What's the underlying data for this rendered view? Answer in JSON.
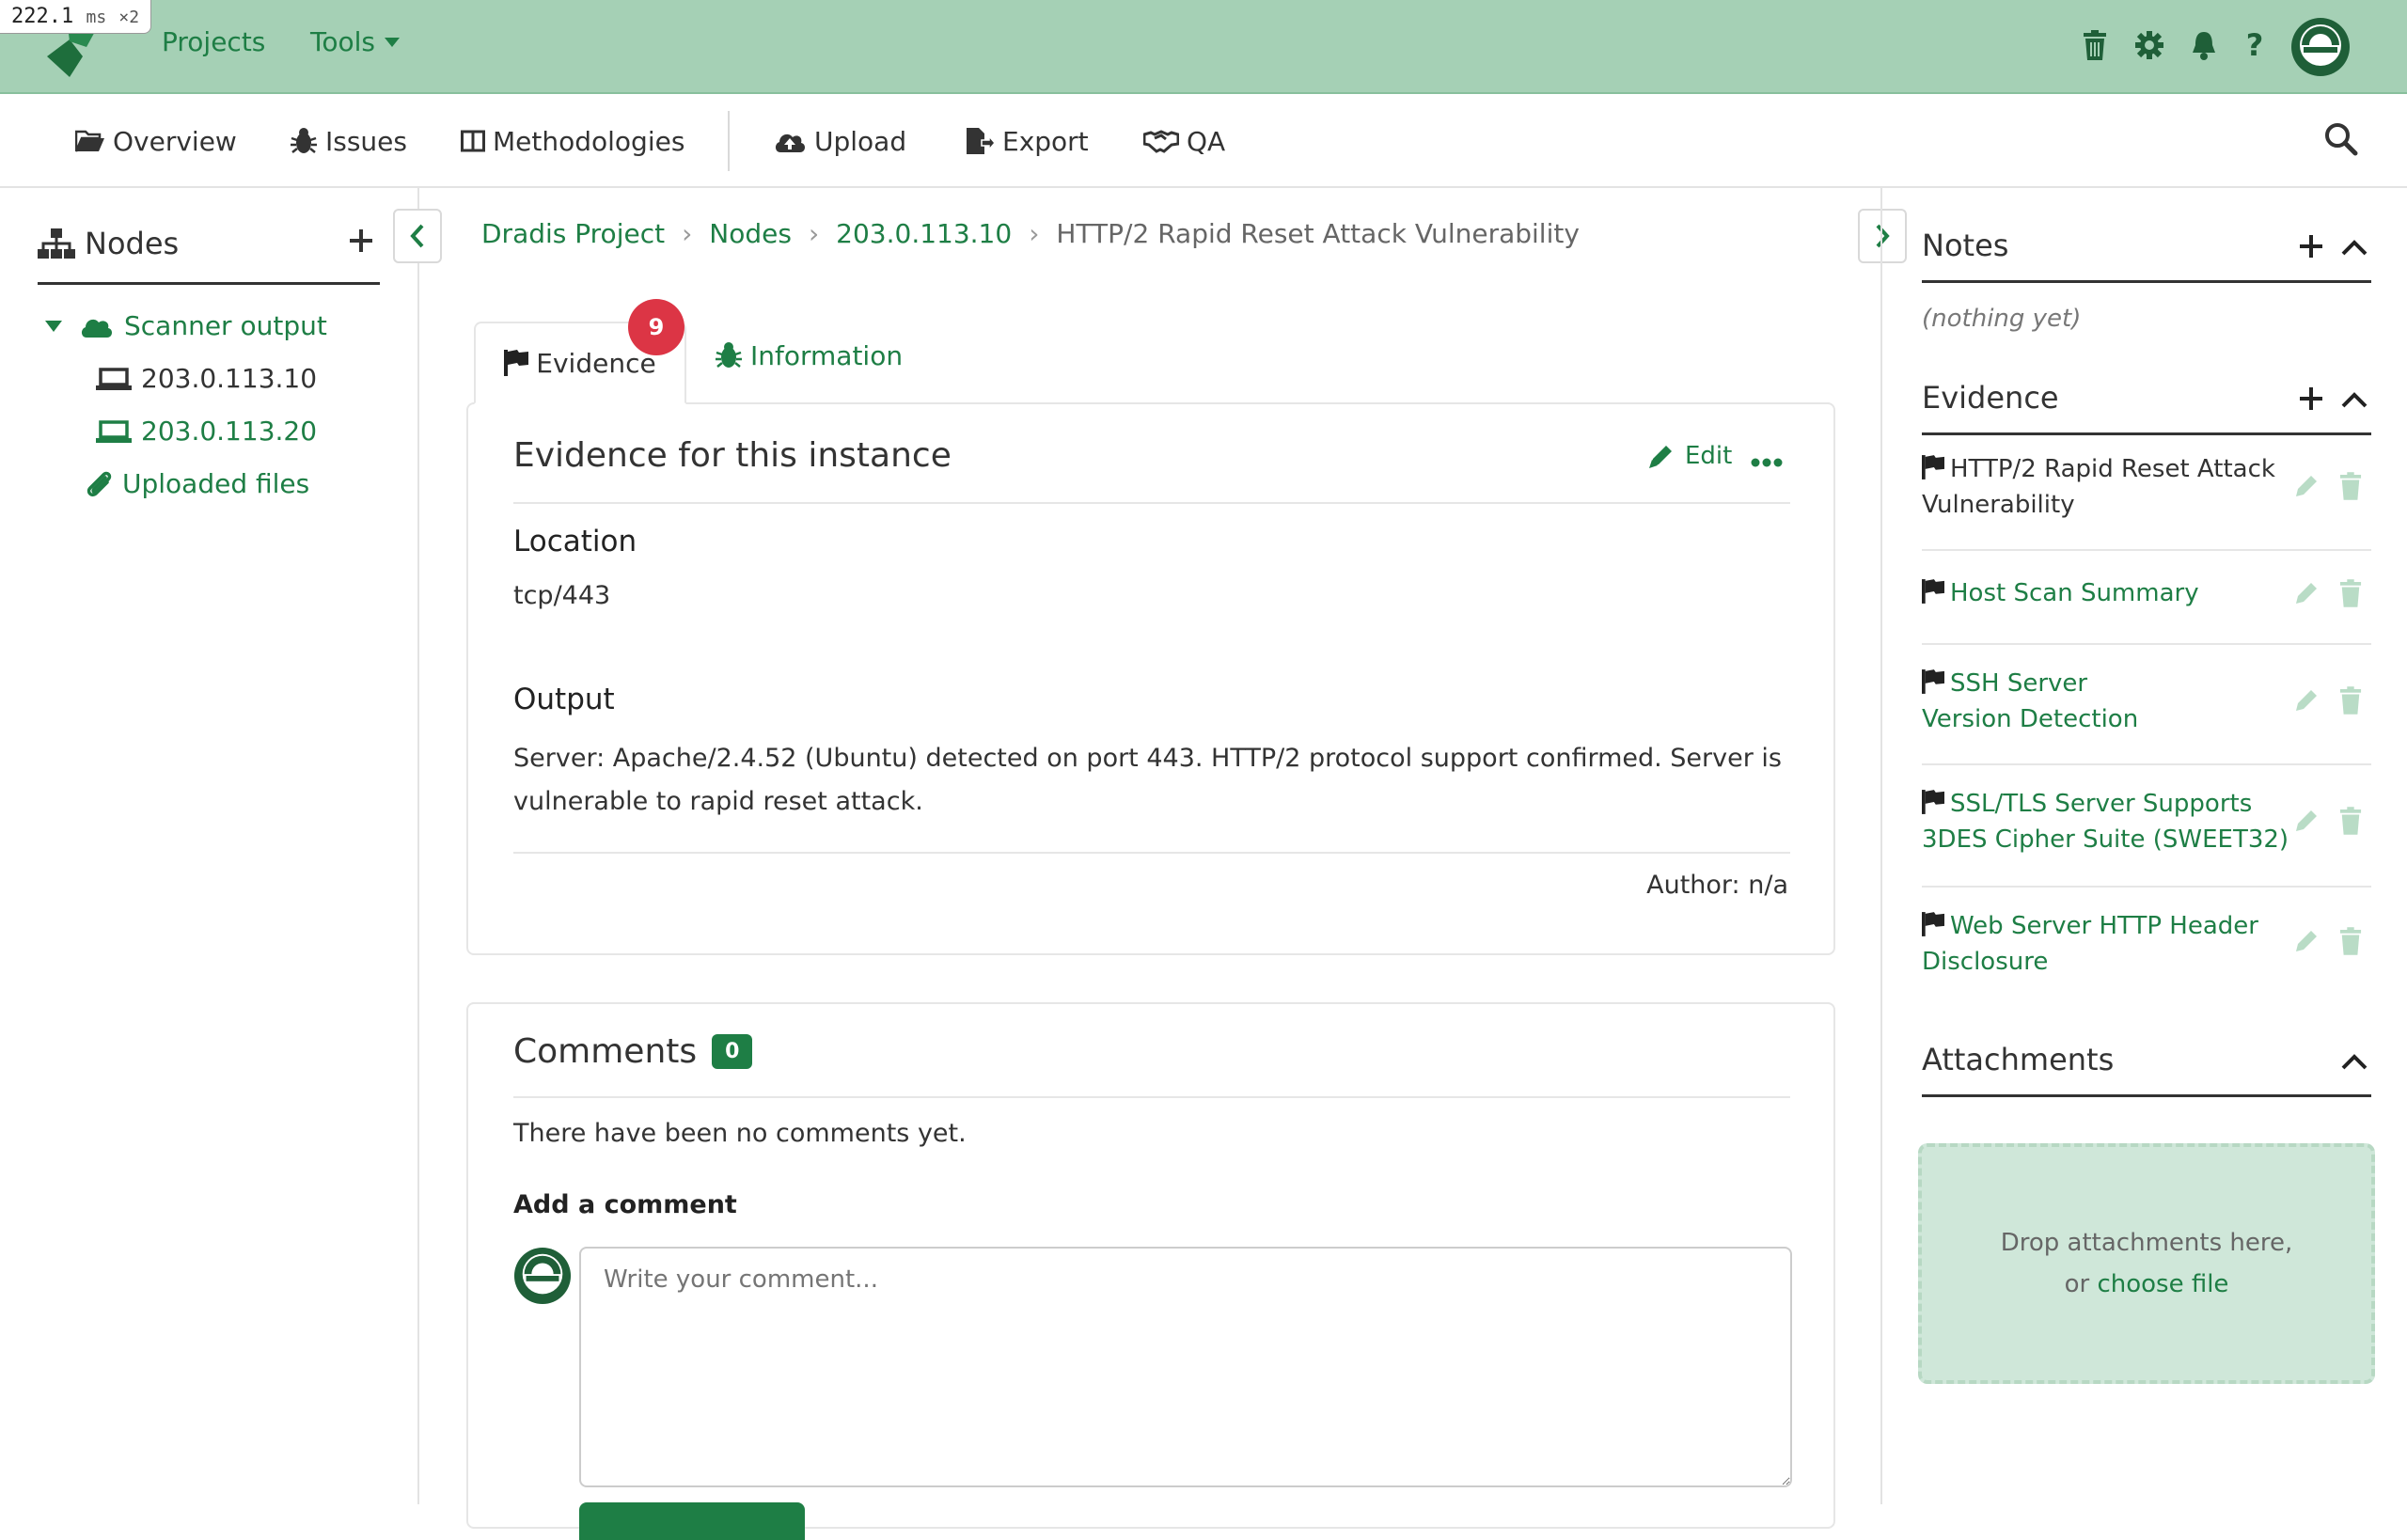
{
  "perf": {
    "value": "222.1",
    "unit": "ms",
    "mult": "×2"
  },
  "topbar": {
    "projects": "Projects",
    "tools": "Tools",
    "icons": [
      "trash-icon",
      "gear-icon",
      "bell-icon",
      "question-icon",
      "avatar"
    ]
  },
  "subnav": {
    "overview": "Overview",
    "issues": "Issues",
    "methodologies": "Methodologies",
    "upload": "Upload",
    "export": "Export",
    "qa": "QA"
  },
  "left": {
    "title": "Nodes",
    "tree": {
      "scanner": "Scanner output",
      "host1": "203.0.113.10",
      "host2": "203.0.113.20",
      "uploaded": "Uploaded files"
    }
  },
  "breadcrumb": [
    "Dradis Project",
    "Nodes",
    "203.0.113.10",
    "HTTP/2 Rapid Reset Attack Vulnerability"
  ],
  "tabs": {
    "evidence": "Evidence",
    "evidence_badge": "9",
    "information": "Information"
  },
  "evidence": {
    "title": "Evidence for this instance",
    "edit": "Edit",
    "location_label": "Location",
    "location_value": "tcp/443",
    "output_label": "Output",
    "output_line1": "Server: Apache/2.4.52 (Ubuntu) detected on port 443. HTTP/2 protocol support confirmed. Server is",
    "output_line2": "vulnerable to rapid reset attack.",
    "author": "Author: n/a"
  },
  "comments": {
    "title": "Comments",
    "count": "0",
    "empty": "There have been no comments yet.",
    "add_label": "Add a comment",
    "placeholder": "Write your comment..."
  },
  "right": {
    "notes_title": "Notes",
    "notes_empty": "(nothing yet)",
    "evidence_title": "Evidence",
    "evidence_items": [
      {
        "line1": "HTTP/2 Rapid Reset Attack",
        "line2": "Vulnerability"
      },
      {
        "line1": "Host Scan Summary",
        "line2": ""
      },
      {
        "line1": "SSH Server",
        "line2": "Version Detection"
      },
      {
        "line1": "SSL/TLS Server Supports",
        "line2": "3DES Cipher Suite (SWEET32)"
      },
      {
        "line1": "Web Server HTTP Header",
        "line2": "Disclosure"
      }
    ],
    "attachments_title": "Attachments",
    "drop_line1": "Drop attachments here,",
    "drop_line2_prefix": "or ",
    "drop_link": "choose file"
  },
  "colors": {
    "brand_green": "#1e7e45",
    "topbar_bg": "#a5d0b5",
    "badge_red": "#dc3545",
    "drop_bg": "#cfe7d9"
  }
}
